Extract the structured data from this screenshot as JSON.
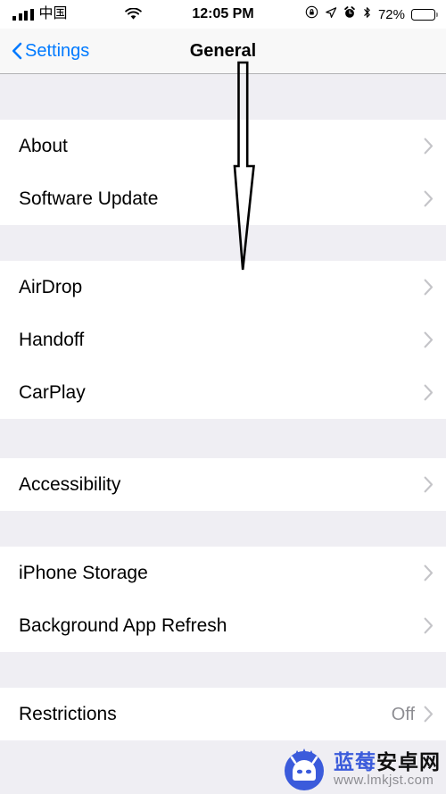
{
  "status_bar": {
    "carrier": "中国",
    "signal_bars": 4,
    "signal_bars_filled": 4,
    "wifi_icon": "wifi-icon",
    "time": "12:05 PM",
    "icons": [
      "rotation-lock-icon",
      "location-arrow-icon",
      "alarm-clock-icon",
      "bluetooth-icon"
    ],
    "battery_percent": "72%",
    "battery_level": 72
  },
  "nav_bar": {
    "back_label": "Settings",
    "back_icon": "chevron-left-icon",
    "title": "General"
  },
  "sections": [
    {
      "rows": [
        {
          "label": "About",
          "value": "",
          "accessory": "chevron-right-icon"
        },
        {
          "label": "Software Update",
          "value": "",
          "accessory": "chevron-right-icon"
        }
      ]
    },
    {
      "rows": [
        {
          "label": "AirDrop",
          "value": "",
          "accessory": "chevron-right-icon"
        },
        {
          "label": "Handoff",
          "value": "",
          "accessory": "chevron-right-icon"
        },
        {
          "label": "CarPlay",
          "value": "",
          "accessory": "chevron-right-icon"
        }
      ]
    },
    {
      "rows": [
        {
          "label": "Accessibility",
          "value": "",
          "accessory": "chevron-right-icon"
        }
      ]
    },
    {
      "rows": [
        {
          "label": "iPhone Storage",
          "value": "",
          "accessory": "chevron-right-icon"
        },
        {
          "label": "Background App Refresh",
          "value": "",
          "accessory": "chevron-right-icon"
        }
      ]
    },
    {
      "rows": [
        {
          "label": "Restrictions",
          "value": "Off",
          "accessory": "chevron-right-icon"
        }
      ]
    }
  ],
  "annotation": {
    "type": "down-arrow-outline",
    "color": "#000000"
  },
  "watermark": {
    "logo": "blueberry-android-robot-logo",
    "text_blue": "蓝莓",
    "text_dark": "安卓网",
    "url": "www.lmkjst.com",
    "color_blue": "#3b5bdb",
    "color_dark": "#111111",
    "color_url": "#8d8d92"
  },
  "colors": {
    "accent": "#007aff",
    "group_background": "#efeef3",
    "row_background": "#ffffff",
    "separator": "#c8c7cc",
    "secondary_text": "#8e8e93"
  }
}
